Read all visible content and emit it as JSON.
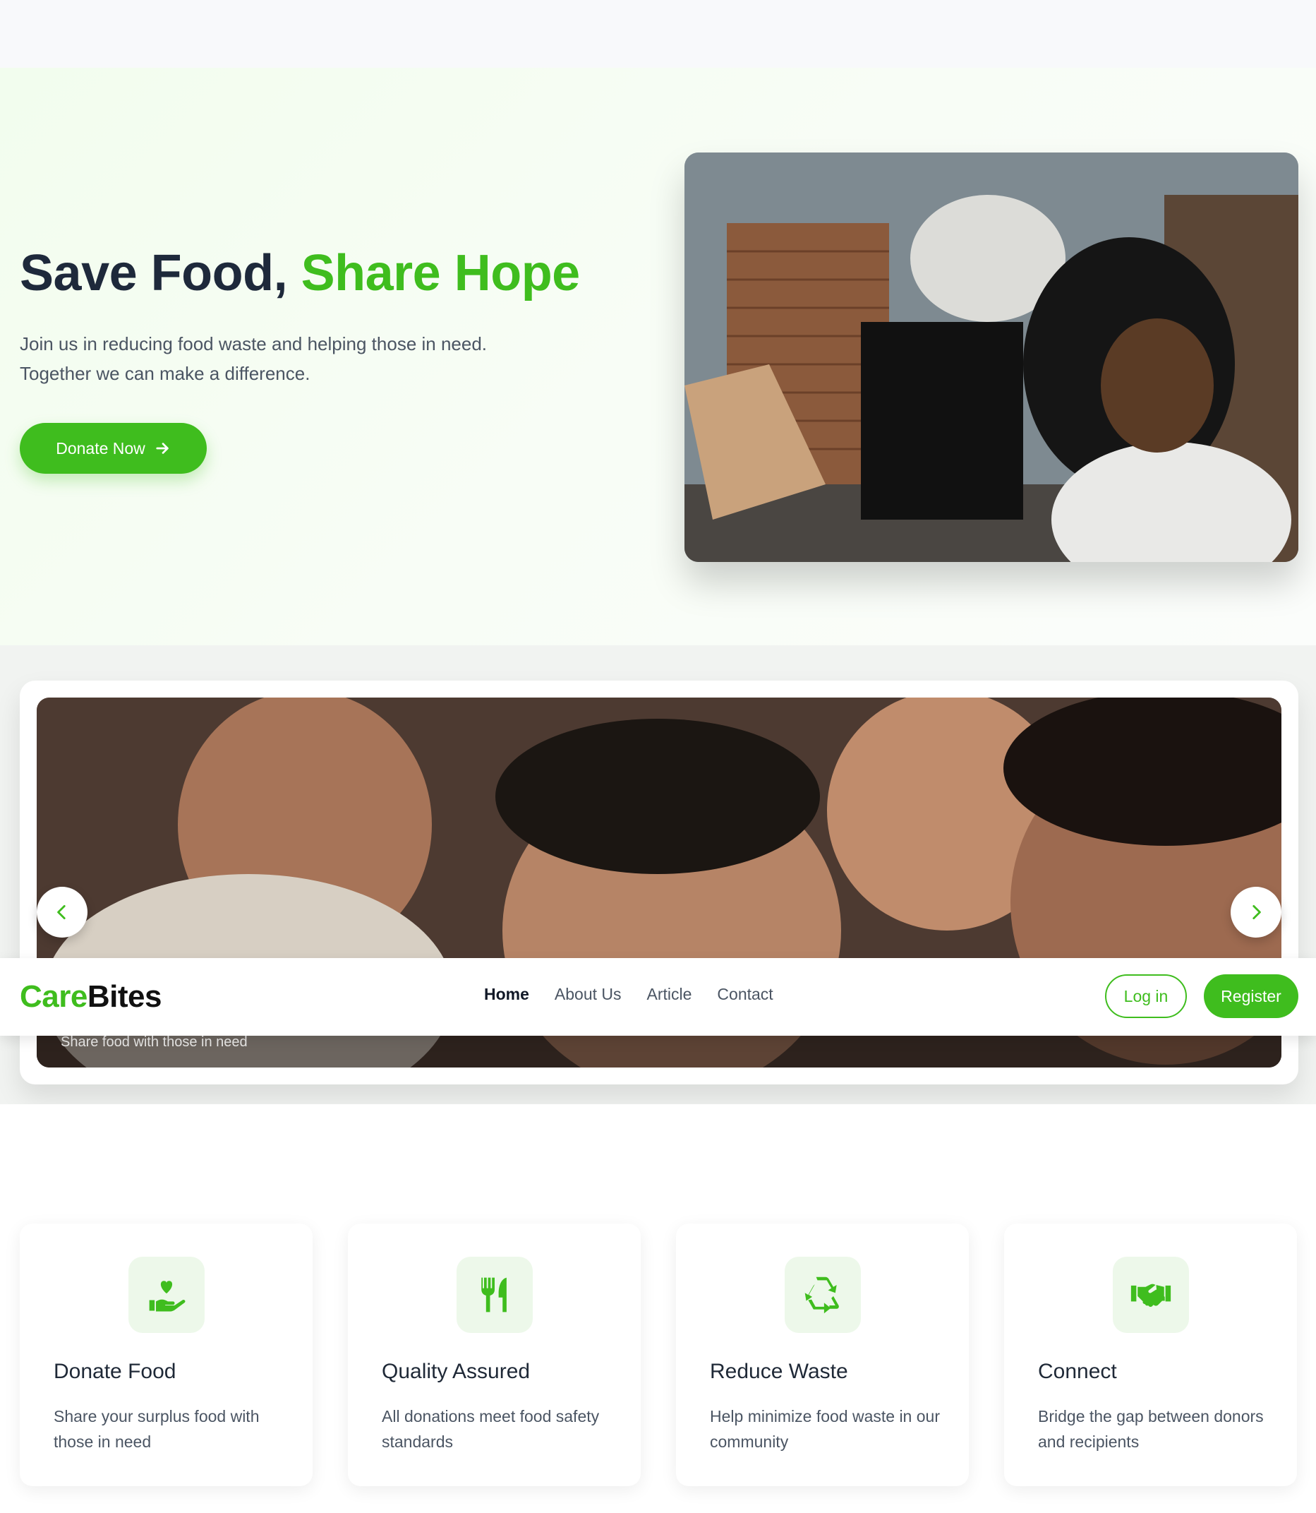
{
  "hero": {
    "title_main": "Save Food,",
    "title_accent": "Share Hope",
    "subtitle": "Join us in reducing food waste and helping those in need. Together we can make a difference.",
    "cta_label": "Donate Now"
  },
  "carousel": {
    "caption": "Share food with those in need"
  },
  "navbar": {
    "logo_part1": "Care",
    "logo_part2": "Bites",
    "links": [
      "Home",
      "About Us",
      "Article",
      "Contact"
    ],
    "active_link": "Home",
    "login_label": "Log in",
    "register_label": "Register"
  },
  "features": [
    {
      "icon": "hand-holding-heart-icon",
      "title": "Donate Food",
      "description": "Share your surplus food with those in need"
    },
    {
      "icon": "utensils-icon",
      "title": "Quality Assured",
      "description": "All donations meet food safety standards"
    },
    {
      "icon": "recycle-icon",
      "title": "Reduce Waste",
      "description": "Help minimize food waste in our community"
    },
    {
      "icon": "handshake-icon",
      "title": "Connect",
      "description": "Bridge the gap between donors and recipients"
    }
  ],
  "colors": {
    "brand_green": "#3fbd1e",
    "dark_text": "#1e293b",
    "icon_bg": "#edf8ea"
  }
}
